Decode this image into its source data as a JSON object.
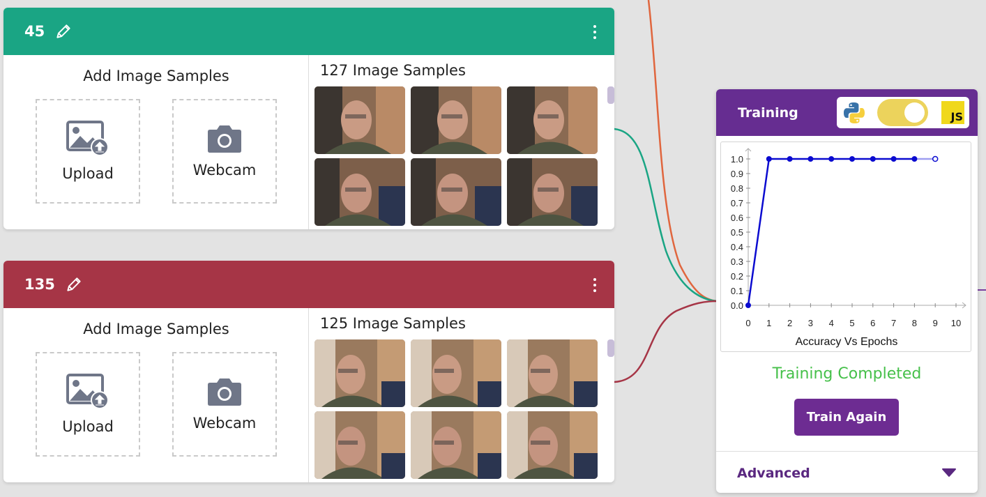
{
  "colors": {
    "class1_header": "#1aa584",
    "class2_header": "#a63546",
    "training_header": "#662d91",
    "training_completed": "#46c04a",
    "chart_line": "#0b0bd0"
  },
  "classes": [
    {
      "name": "45",
      "add_samples_label": "Add Image Samples",
      "upload_label": "Upload",
      "webcam_label": "Webcam",
      "samples_count_label": "127 Image Samples"
    },
    {
      "name": "135",
      "add_samples_label": "Add Image Samples",
      "upload_label": "Upload",
      "webcam_label": "Webcam",
      "samples_count_label": "125 Image Samples"
    }
  ],
  "training": {
    "title": "Training",
    "selected_language": "JS",
    "status": "Training Completed",
    "train_again_label": "Train Again",
    "advanced_label": "Advanced"
  },
  "chart_data": {
    "type": "line",
    "title": "Accuracy Vs Epochs",
    "xlabel": "",
    "ylabel": "",
    "x": [
      0,
      1,
      2,
      3,
      4,
      5,
      6,
      7,
      8,
      9
    ],
    "series": [
      {
        "values": [
          0.0,
          1.0,
          1.0,
          1.0,
          1.0,
          1.0,
          1.0,
          1.0,
          1.0,
          1.0
        ]
      }
    ],
    "xlim": [
      0,
      10
    ],
    "ylim": [
      0,
      1.0
    ],
    "x_ticks": [
      "0",
      "1",
      "2",
      "3",
      "4",
      "5",
      "6",
      "7",
      "8",
      "9",
      "10"
    ],
    "y_ticks": [
      "0.0",
      "0.1",
      "0.2",
      "0.3",
      "0.4",
      "0.5",
      "0.6",
      "0.7",
      "0.8",
      "0.9",
      "1.0"
    ],
    "grid": false,
    "legend": "none"
  }
}
